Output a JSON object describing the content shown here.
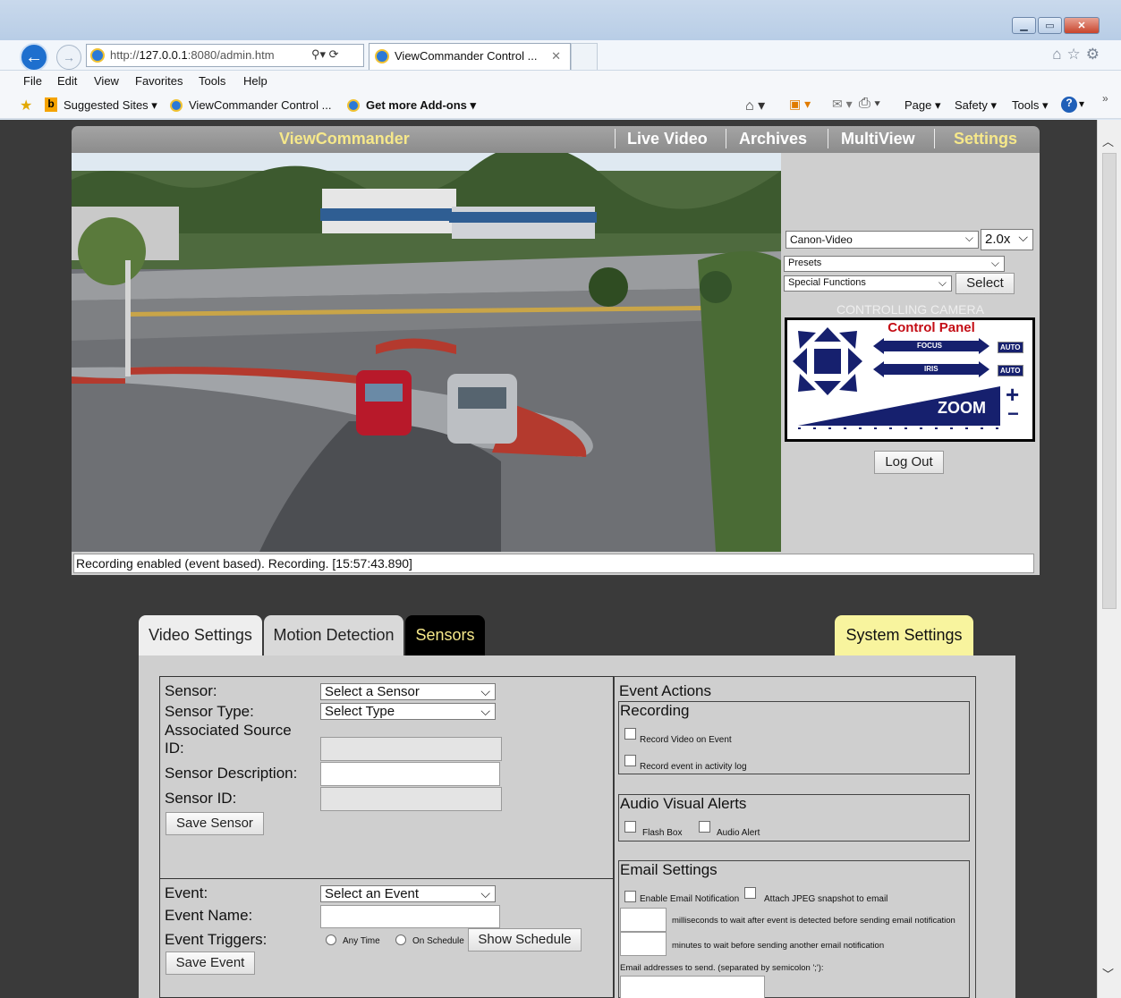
{
  "browser": {
    "url_prefix": "http://",
    "url_host": "127.0.0.1",
    "url_rest": ":8080/admin.htm",
    "tab_title": "ViewCommander Control ...",
    "menu": [
      "File",
      "Edit",
      "View",
      "Favorites",
      "Tools",
      "Help"
    ],
    "favorites": {
      "suggested": "Suggested Sites ▾",
      "viewcommander": "ViewCommander Control ...",
      "addons": "Get more Add-ons ▾"
    },
    "commands": [
      "Page ▾",
      "Safety ▾",
      "Tools ▾"
    ]
  },
  "app": {
    "title": "ViewCommander",
    "nav": [
      "Live Video",
      "Archives",
      "MultiView",
      "Settings"
    ],
    "active_nav": "Settings",
    "status": "Recording enabled (event based). Recording. [15:57:43.890]"
  },
  "camera_panel": {
    "camera_select": "Canon-Video",
    "zoom_select": "2.0x",
    "presets_select": "Presets",
    "special_select": "Special Functions",
    "select_button": "Select",
    "controlling_label": "CONTROLLING CAMERA",
    "control_panel_title": "Control Panel",
    "focus_label": "FOCUS",
    "iris_label": "IRIS",
    "auto_label": "AUTO",
    "zoom_label": "ZOOM",
    "plus": "+",
    "minus": "−",
    "logout_button": "Log Out"
  },
  "tabs": {
    "video": "Video Settings",
    "motion": "Motion Detection",
    "sensors": "Sensors",
    "system": "System Settings"
  },
  "sensor_form": {
    "sensor_label": "Sensor:",
    "sensor_select": "Select a Sensor",
    "type_label": "Sensor Type:",
    "type_select": "Select Type",
    "assoc_label_1": "Associated Source",
    "assoc_label_2": "ID:",
    "desc_label": "Sensor Description:",
    "id_label": "Sensor ID:",
    "save_sensor": "Save Sensor",
    "event_label": "Event:",
    "event_select": "Select an Event",
    "event_name_label": "Event Name:",
    "triggers_label": "Event Triggers:",
    "any_time": "Any Time",
    "on_schedule": "On Schedule",
    "show_schedule": "Show Schedule",
    "save_event": "Save Event"
  },
  "event_actions": {
    "title": "Event Actions",
    "recording_title": "Recording",
    "record_video": "Record Video on Event",
    "record_log": "Record event in activity log",
    "av_title": "Audio Visual Alerts",
    "flash_box": "Flash Box",
    "audio_alert": "Audio Alert",
    "email_title": "Email Settings",
    "enable_email": "Enable Email Notification",
    "attach_jpeg": "Attach JPEG snapshot to email",
    "ms_wait": "milliseconds to wait after event is detected before sending email notification",
    "min_wait": "minutes to wait before sending another email notification",
    "addresses": "Email addresses to send. (separated by semicolon ';'):"
  }
}
